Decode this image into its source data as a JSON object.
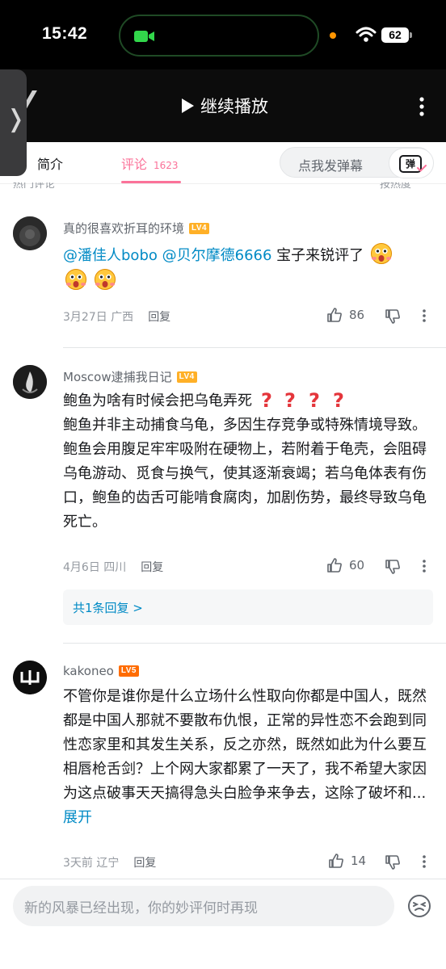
{
  "status": {
    "time": "15:42",
    "battery": "62"
  },
  "player": {
    "continue_play": "继续播放"
  },
  "tabs": {
    "intro": "简介",
    "comments": "评论",
    "comment_count": "1623",
    "danmaku_placeholder": "点我发弹幕",
    "danmaku_icon_char": "弹",
    "peek_left": "热门评论",
    "peek_right": "按热度"
  },
  "comments": [
    {
      "user": "真的很喜欢折耳的环境",
      "level": "LV4",
      "mention1": "@潘佳人bobo",
      "mention2": "@贝尔摩德6666",
      "text": " 宝子来锐评了",
      "date": "3月27日",
      "location": "广西",
      "reply": "回复",
      "likes": "86"
    },
    {
      "user": "Moscow逮捕我日记",
      "level": "LV4",
      "line1": "鲍鱼为啥有时候会把乌龟弄死",
      "body": "鲍鱼并非主动捕食乌龟，多因生存竞争或特殊情境导致。鲍鱼会用腹足牢牢吸附在硬物上，若附着于龟壳，会阻碍乌龟游动、觅食与换气，使其逐渐衰竭；若乌龟体表有伤口，鲍鱼的齿舌可能啃食腐肉，加剧伤势，最终导致乌龟死亡。",
      "date": "4月6日",
      "location": "四川",
      "reply": "回复",
      "likes": "60",
      "replies_link": "共1条回复 >"
    },
    {
      "user": "kakoneo",
      "level": "LV5",
      "body": "不管你是谁你是什么立场什么性取向你都是中国人，既然都是中国人那就不要散布仇恨，正常的异性恋不会跑到同性恋家里和其发生关系，反之亦然，既然如此为什么要互相唇枪舌剑？上个网大家都累了一天了，我不希望大家因为这点破事天天搞得急头白脸争来争去，这除了破坏和...",
      "expand": "展开",
      "date": "3天前",
      "location": "辽宁",
      "reply": "回复",
      "likes": "14"
    }
  ],
  "bottom": {
    "input_placeholder": "新的风暴已经出现，你的妙评何时再现"
  },
  "colors": {
    "accent": "#fb7299",
    "link": "#008ac5",
    "lv4": "#ffb027",
    "lv5": "#ff6c00"
  }
}
